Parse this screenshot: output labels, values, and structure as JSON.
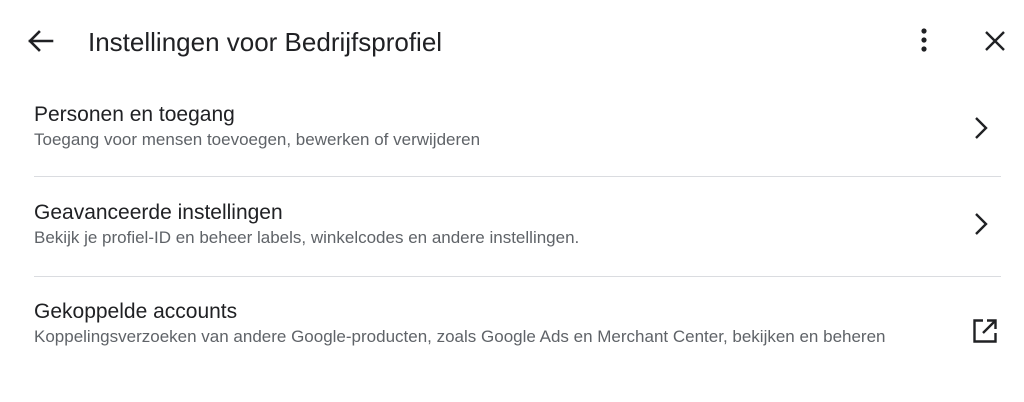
{
  "header": {
    "title": "Instellingen voor Bedrijfsprofiel",
    "back_icon": "arrow-back-icon",
    "more_icon": "more-vert-icon",
    "close_icon": "close-icon"
  },
  "settings": [
    {
      "title": "Personen en toegang",
      "description": "Toegang voor mensen toevoegen, bewerken of verwijderen",
      "action_icon": "chevron-right-icon"
    },
    {
      "title": "Geavanceerde instellingen",
      "description": "Bekijk je profiel-ID en beheer labels, winkelcodes en andere instellingen.",
      "action_icon": "chevron-right-icon"
    },
    {
      "title": "Gekoppelde accounts",
      "description": "Koppelingsverzoeken van andere Google-producten, zoals Google Ads en Merchant Center, bekijken en beheren",
      "action_icon": "open-in-new-icon"
    }
  ],
  "colors": {
    "text_primary": "#202124",
    "text_secondary": "#5f6368",
    "divider": "#dadce0",
    "background": "#ffffff"
  }
}
